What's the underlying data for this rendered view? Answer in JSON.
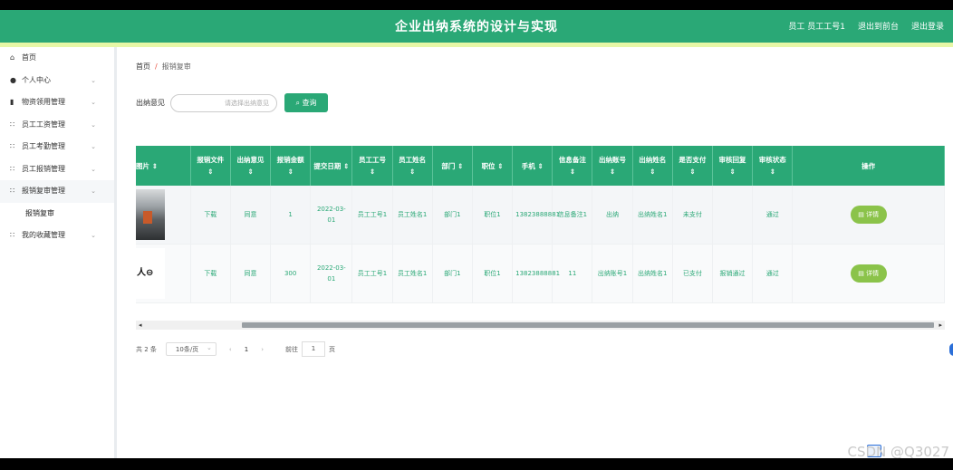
{
  "header": {
    "title": "企业出纳系统的设计与实现",
    "user_label": "员工 员工工号1",
    "back_label": "退出到前台",
    "logout_label": "退出登录"
  },
  "sidebar": {
    "items": [
      {
        "icon": "home-icon",
        "label": "首页",
        "has_chevron": false
      },
      {
        "icon": "user-icon",
        "label": "个人中心",
        "has_chevron": true
      },
      {
        "icon": "book-icon",
        "label": "物资领用管理",
        "has_chevron": true
      },
      {
        "icon": "grid-icon",
        "label": "员工工资管理",
        "has_chevron": true
      },
      {
        "icon": "grid-icon",
        "label": "员工考勤管理",
        "has_chevron": true
      },
      {
        "icon": "grid-icon",
        "label": "员工报销管理",
        "has_chevron": true
      },
      {
        "icon": "grid-icon",
        "label": "报销复审管理",
        "has_chevron": true
      },
      {
        "icon": "",
        "label": "报销复审",
        "has_chevron": false,
        "sub": true
      },
      {
        "icon": "grid-icon",
        "label": "我的收藏管理",
        "has_chevron": true
      }
    ]
  },
  "breadcrumb": {
    "home": "首页",
    "separator": "/",
    "current": "报销复审"
  },
  "search": {
    "label": "出纳意见",
    "placeholder": "请选择出纳意见",
    "button": "查询"
  },
  "table": {
    "headers": [
      "图片",
      "报销文件",
      "出纳意见",
      "报销金额",
      "提交日期",
      "员工工号",
      "员工姓名",
      "部门",
      "职位",
      "手机",
      "信息备注",
      "出纳账号",
      "出纳姓名",
      "是否支付",
      "审核回复",
      "审核状态",
      "操作"
    ],
    "rows": [
      {
        "image": "office-photo",
        "file": "下载",
        "opinion": "同意",
        "amount": "1",
        "date": "2022-03-01",
        "emp_no": "员工工号1",
        "emp_name": "员工姓名1",
        "dept": "部门1",
        "position": "职位1",
        "phone": "13823888881",
        "note": "信息备注1",
        "cashier_no": "出纳",
        "cashier_name": "出纳姓名1",
        "paid": "未支付",
        "reply": "",
        "status": "通过",
        "action": "详情"
      },
      {
        "image": "text-image",
        "image_text": "人⊖",
        "file": "下载",
        "opinion": "同意",
        "amount": "300",
        "date": "2022-03-01",
        "emp_no": "员工工号1",
        "emp_name": "员工姓名1",
        "dept": "部门1",
        "position": "职位1",
        "phone": "13823888881",
        "note": "11",
        "cashier_no": "出纳账号1",
        "cashier_name": "出纳姓名1",
        "paid": "已支付",
        "reply": "报销通过",
        "status": "通过",
        "action": "详情"
      }
    ]
  },
  "pagination": {
    "total": "共 2 条",
    "page_size": "10条/页",
    "prev": "‹",
    "current_page": "1",
    "next": "›",
    "goto_label": "前往",
    "goto_value": "1",
    "goto_unit": "页"
  },
  "watermark": "CSDN @Q3027"
}
